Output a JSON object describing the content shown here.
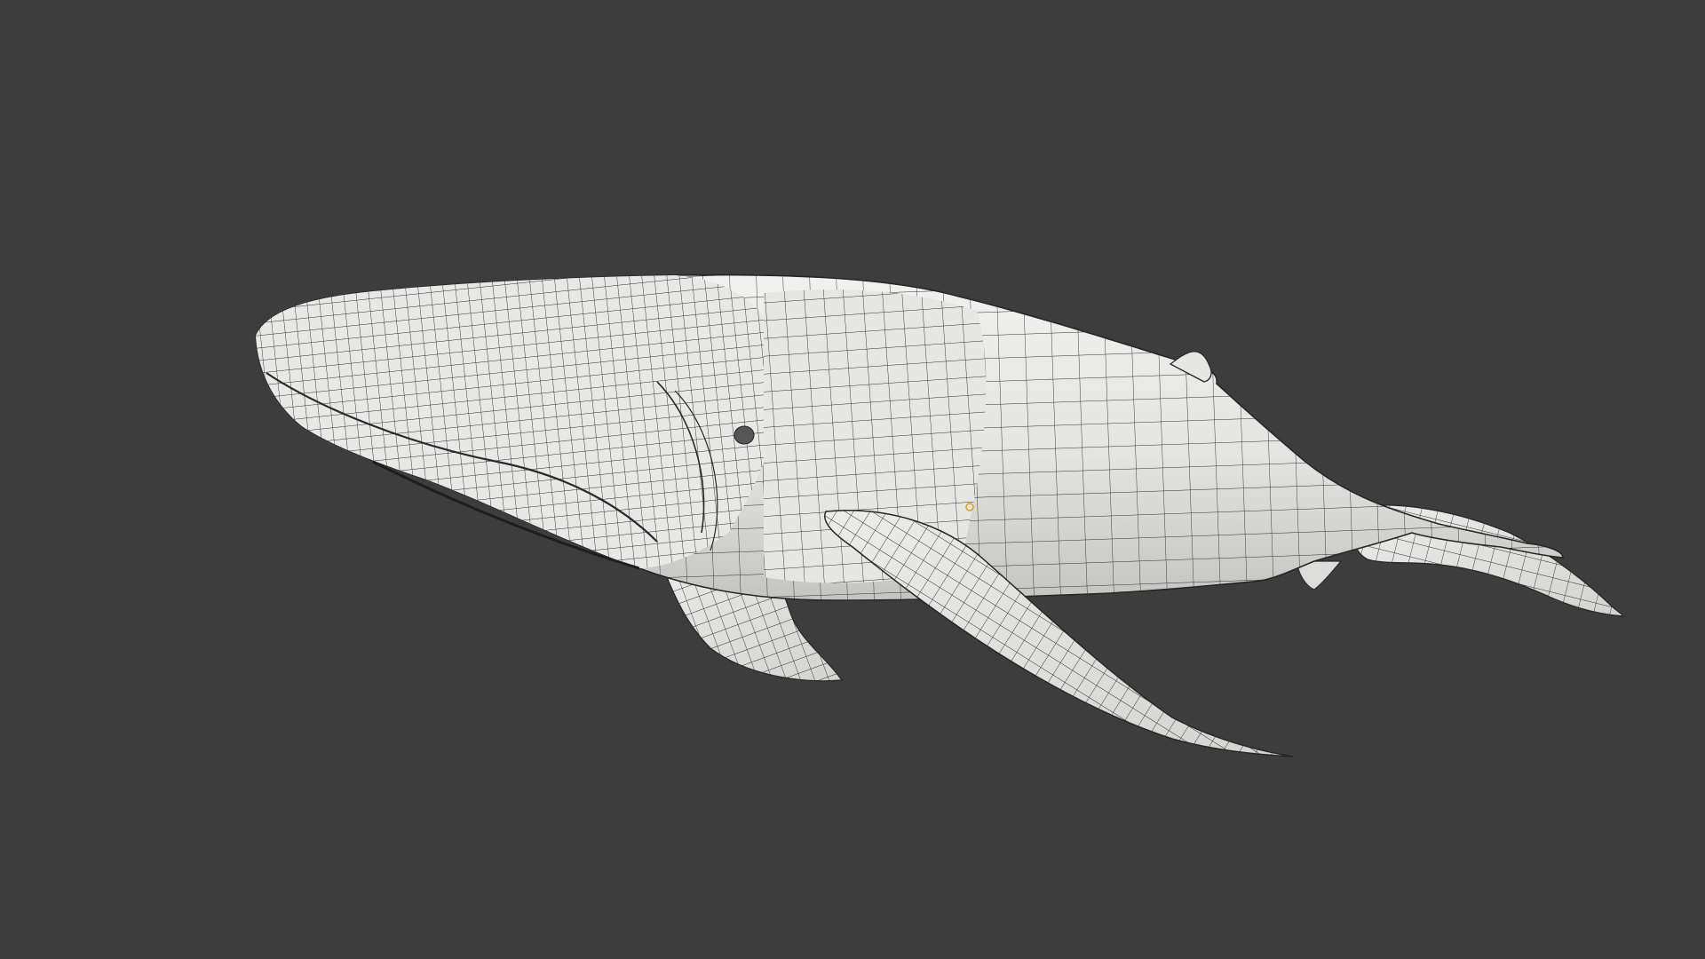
{
  "viewport": {
    "background_color": "#3d3d3d",
    "mesh_fill_color": "#e6e6e4",
    "mesh_shade_color": "#c9c9c6",
    "wire_color": "#2a2a2a",
    "origin_marker_color": "#e0a020"
  },
  "scene": {
    "object_kind": "humpback-whale-mesh",
    "display_mode": "solid-with-wireframe",
    "object_origin_visible": true
  }
}
